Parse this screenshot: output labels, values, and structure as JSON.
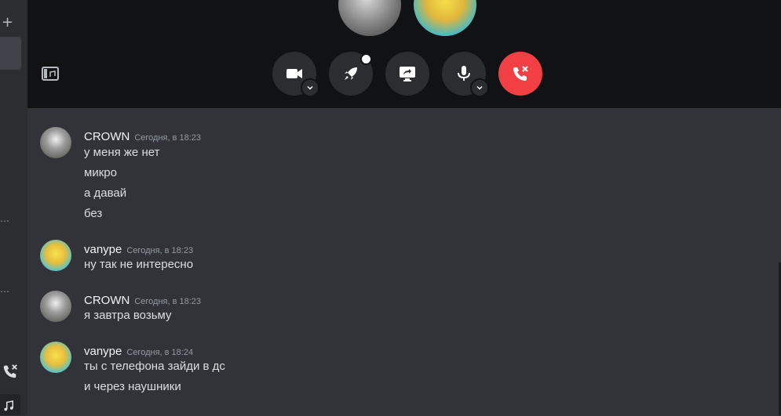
{
  "call": {
    "controls": [
      {
        "name": "camera",
        "label": "video-camera-icon"
      },
      {
        "name": "activities",
        "label": "rocket-icon"
      },
      {
        "name": "screen-share",
        "label": "screen-share-icon"
      },
      {
        "name": "microphone",
        "label": "microphone-icon"
      },
      {
        "name": "hang-up",
        "label": "hang-up-icon"
      }
    ],
    "colors": {
      "hangup": "#f23f43",
      "control_bg": "#2b2d31",
      "call_bg": "#111214"
    }
  },
  "messages": [
    {
      "author": "CROWN",
      "timestamp": "Сегодня, в 18:23",
      "lines": [
        "у меня же нет",
        "микро",
        "а давай",
        "без"
      ]
    },
    {
      "author": "vanype",
      "timestamp": "Сегодня, в 18:23",
      "lines": [
        "ну так не интересно"
      ]
    },
    {
      "author": "CROWN",
      "timestamp": "Сегодня, в 18:23",
      "lines": [
        "я завтра возьму"
      ]
    },
    {
      "author": "vanype",
      "timestamp": "Сегодня, в 18:24",
      "lines": [
        "ты с телефона зайди в дс",
        "и через наушники"
      ]
    }
  ]
}
